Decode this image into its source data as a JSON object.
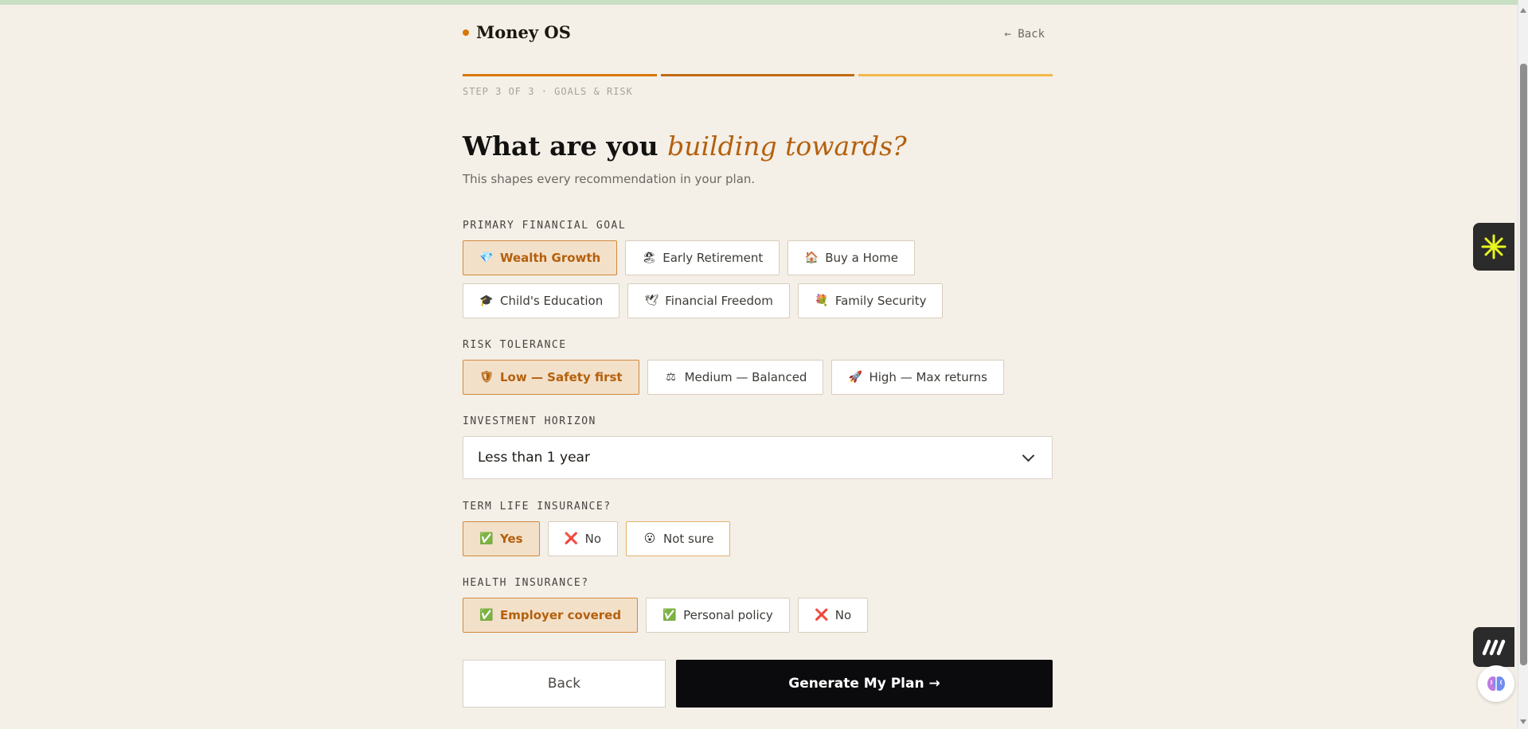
{
  "app": {
    "brand": "Money OS",
    "back_link": "← Back"
  },
  "progress": {
    "step_label": "STEP 3 OF 3 · GOALS & RISK",
    "segments": [
      "#d97706",
      "#c26a12",
      "#f2b84b"
    ]
  },
  "hero": {
    "title_plain": "What are you ",
    "title_accent": "building towards?",
    "subtitle": "This shapes every recommendation in your plan."
  },
  "goal": {
    "label": "PRIMARY FINANCIAL GOAL",
    "options": [
      {
        "icon": "💎",
        "label": "Wealth Growth"
      },
      {
        "icon": "🏖",
        "label": "Early Retirement"
      },
      {
        "icon": "🏠",
        "label": "Buy a Home"
      },
      {
        "icon": "🎓",
        "label": "Child's Education"
      },
      {
        "icon": "🕊",
        "label": "Financial Freedom"
      },
      {
        "icon": "💐",
        "label": "Family Security"
      }
    ],
    "selected": "Wealth Growth"
  },
  "risk": {
    "label": "RISK TOLERANCE",
    "options": [
      {
        "icon": "🛡",
        "label": "Low — Safety first"
      },
      {
        "icon": "⚖",
        "label": "Medium — Balanced"
      },
      {
        "icon": "🚀",
        "label": "High — Max returns"
      }
    ],
    "selected": "Low — Safety first"
  },
  "horizon": {
    "label": "INVESTMENT HORIZON",
    "value": "Less than 1 year"
  },
  "term_life": {
    "label": "TERM LIFE INSURANCE?",
    "options": [
      {
        "icon": "✅",
        "label": "Yes"
      },
      {
        "icon": "❌",
        "label": "No"
      },
      {
        "icon": "😮",
        "label": "Not sure"
      }
    ],
    "selected": "Yes"
  },
  "health": {
    "label": "HEALTH INSURANCE?",
    "options": [
      {
        "icon": "✅",
        "label": "Employer covered"
      },
      {
        "icon": "✅",
        "label": "Personal policy"
      },
      {
        "icon": "❌",
        "label": "No"
      }
    ],
    "selected": "Employer covered"
  },
  "actions": {
    "back": "Back",
    "generate": "Generate My Plan →"
  },
  "colors": {
    "accent": "#b4600d",
    "selected_bg": "#f3e0c9",
    "primary_button": "#0b0b0e"
  }
}
